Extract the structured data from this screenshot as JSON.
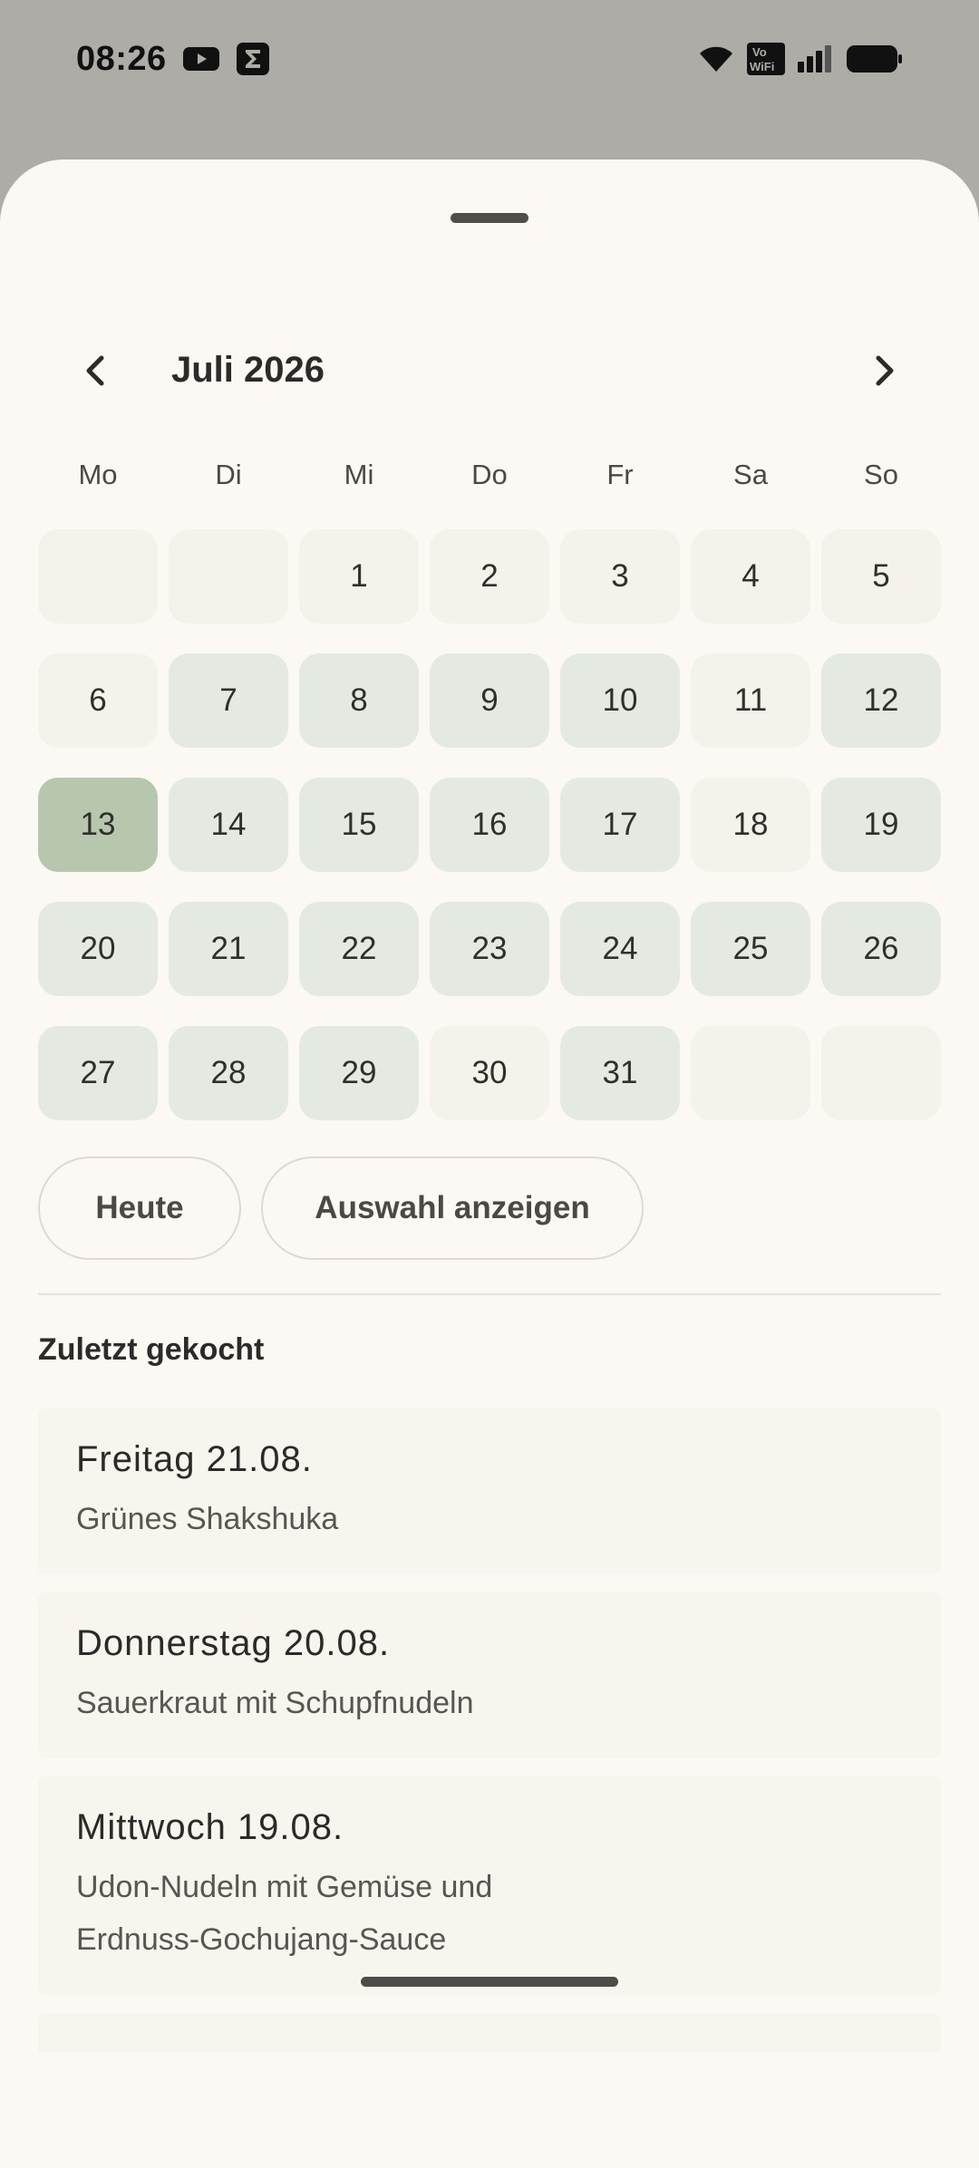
{
  "status_bar": {
    "time": "08:26",
    "vowifi_top": "Vo",
    "vowifi_bottom": "WiFi"
  },
  "calendar": {
    "month_title": "Juli 2026",
    "weekdays": [
      "Mo",
      "Di",
      "Mi",
      "Do",
      "Fr",
      "Sa",
      "So"
    ],
    "days": {
      "d1": "1",
      "d2": "2",
      "d3": "3",
      "d4": "4",
      "d5": "5",
      "d6": "6",
      "d7": "7",
      "d8": "8",
      "d9": "9",
      "d10": "10",
      "d11": "11",
      "d12": "12",
      "d13": "13",
      "d14": "14",
      "d15": "15",
      "d16": "16",
      "d17": "17",
      "d18": "18",
      "d19": "19",
      "d20": "20",
      "d21": "21",
      "d22": "22",
      "d23": "23",
      "d24": "24",
      "d25": "25",
      "d26": "26",
      "d27": "27",
      "d28": "28",
      "d29": "29",
      "d30": "30",
      "d31": "31"
    },
    "selected_day": "13"
  },
  "buttons": {
    "today": "Heute",
    "show_selection": "Auswahl anzeigen"
  },
  "recent": {
    "title": "Zuletzt gekocht",
    "items": [
      {
        "day": "Freitag 21.08.",
        "dish": "Grünes Shakshuka"
      },
      {
        "day": "Donnerstag 20.08.",
        "dish": "Sauerkraut mit Schupfnudeln"
      },
      {
        "day": "Mittwoch 19.08.",
        "dish": "Udon-Nudeln mit Gemüse und Erdnuss-Gochujang-Sauce"
      }
    ]
  },
  "colors": {
    "sheet_bg": "#fcf9f4",
    "day_cooked": "#e4e9e1",
    "day_selected": "#b6c7ae",
    "day_plain": "#f5f1eb",
    "scrim": "#aeaca7"
  }
}
